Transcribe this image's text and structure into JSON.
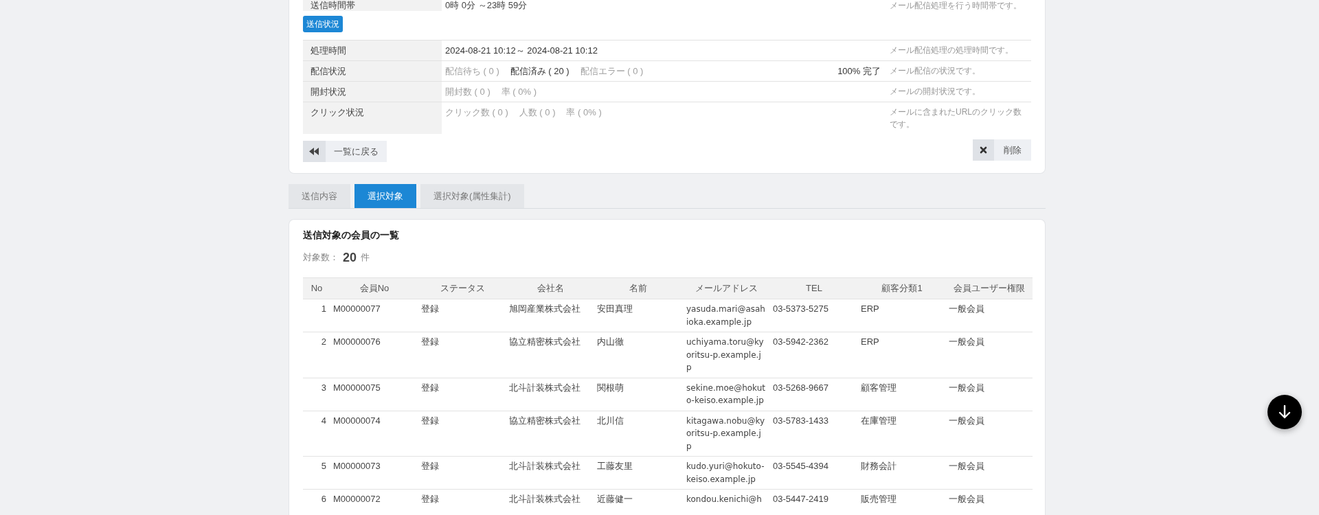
{
  "schedule": {
    "label": "送信時間帯",
    "value": "0時 0分 ～23時 59分",
    "note": "メール配信処理を行う時間帯です。"
  },
  "status": {
    "badge": "送信状況",
    "rows": [
      {
        "label": "処理時間",
        "items": [
          {
            "text": "2024-08-21 10:12～ 2024-08-21 10:12",
            "muted": false
          }
        ],
        "note": "メール配信処理の処理時間です。"
      },
      {
        "label": "配信状況",
        "items": [
          {
            "text": "配信待ち ( 0 )",
            "muted": true
          },
          {
            "text": "配信済み ( 20 )",
            "muted": false
          },
          {
            "text": "配信エラー ( 0 )",
            "muted": true
          }
        ],
        "progress": "100% 完了",
        "note": "メール配信の状況です。"
      },
      {
        "label": "開封状況",
        "items": [
          {
            "text": "開封数 ( 0 )",
            "muted": true
          },
          {
            "text": "率 ( 0% )",
            "muted": true
          }
        ],
        "note": "メールの開封状況です。"
      },
      {
        "label": "クリック状況",
        "items": [
          {
            "text": "クリック数 ( 0 )",
            "muted": true
          },
          {
            "text": "人数 ( 0 )",
            "muted": true
          },
          {
            "text": "率 ( 0% )",
            "muted": true
          }
        ],
        "note": "メールに含まれたURLのクリック数です。"
      }
    ]
  },
  "actions": {
    "back": "一覧に戻る",
    "delete": "削除"
  },
  "tabs": [
    {
      "label": "送信内容",
      "selected": false
    },
    {
      "label": "選択対象",
      "selected": true
    },
    {
      "label": "選択対象(属性集計)",
      "selected": false
    }
  ],
  "members": {
    "title": "送信対象の会員の一覧",
    "count_label": "対象数：",
    "count": "20",
    "count_unit": "件",
    "columns": [
      "No",
      "会員No",
      "ステータス",
      "会社名",
      "名前",
      "メールアドレス",
      "TEL",
      "顧客分類1",
      "会員ユーザー権限"
    ],
    "rows": [
      [
        "1",
        "M00000077",
        "登録",
        "旭岡産業株式会社",
        "安田真理",
        "yasuda.mari@asahioka.example.jp",
        "03-5373-5275",
        "ERP",
        "一般会員"
      ],
      [
        "2",
        "M00000076",
        "登録",
        "協立精密株式会社",
        "内山徹",
        "uchiyama.toru@kyoritsu-p.example.jp",
        "03-5942-2362",
        "ERP",
        "一般会員"
      ],
      [
        "3",
        "M00000075",
        "登録",
        "北斗計装株式会社",
        "関根萌",
        "sekine.moe@hokuto-keiso.example.jp",
        "03-5268-9667",
        "顧客管理",
        "一般会員"
      ],
      [
        "4",
        "M00000074",
        "登録",
        "協立精密株式会社",
        "北川信",
        "kitagawa.nobu@kyoritsu-p.example.jp",
        "03-5783-1433",
        "在庫管理",
        "一般会員"
      ],
      [
        "5",
        "M00000073",
        "登録",
        "北斗計装株式会社",
        "工藤友里",
        "kudo.yuri@hokuto-keiso.example.jp",
        "03-5545-4394",
        "財務会計",
        "一般会員"
      ],
      [
        "6",
        "M00000072",
        "登録",
        "北斗計装株式会社",
        "近藤健一",
        "kondou.kenichi@h",
        "03-5447-2419",
        "販売管理",
        "一般会員"
      ]
    ]
  }
}
